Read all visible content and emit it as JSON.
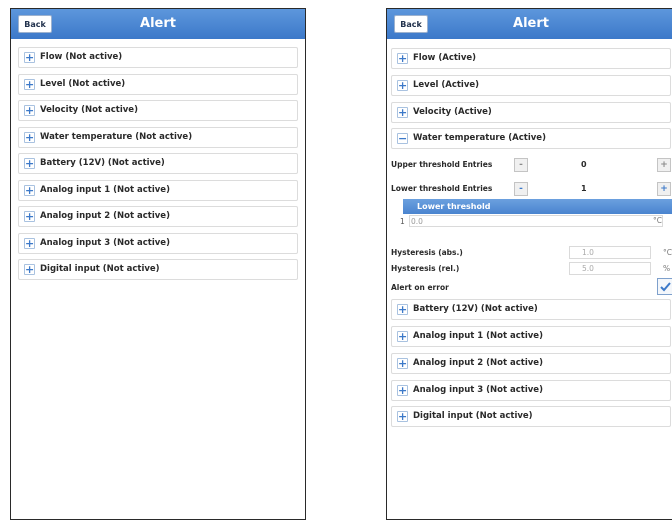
{
  "left": {
    "title": "Alert",
    "back_label": "Back",
    "items": [
      "Flow (Not active)",
      "Level (Not active)",
      "Velocity (Not active)",
      "Water temperature (Not active)",
      "Battery (12V) (Not active)",
      "Analog input 1 (Not active)",
      "Analog input 2 (Not active)",
      "Analog input 3 (Not active)",
      "Digital input (Not active)"
    ]
  },
  "right": {
    "title": "Alert",
    "back_label": "Back",
    "top_items": [
      "Flow (Active)",
      "Level (Active)",
      "Velocity (Active)"
    ],
    "expanded_item": "Water temperature (Active)",
    "upper_threshold": {
      "label": "Upper threshold Entries",
      "minus": "-",
      "value": "0",
      "plus": "+"
    },
    "lower_threshold": {
      "label": "Lower threshold Entries",
      "minus": "-",
      "value": "1",
      "plus": "+"
    },
    "threshold_header": "Lower threshold",
    "threshold_rows": [
      {
        "index": "1",
        "value": "0.0",
        "unit": "°C"
      }
    ],
    "hysteresis_abs": {
      "label": "Hysteresis (abs.)",
      "value": "1.0",
      "unit": "°C"
    },
    "hysteresis_rel": {
      "label": "Hysteresis (rel.)",
      "value": "5.0",
      "unit": "%"
    },
    "alert_on_error": {
      "label": "Alert on error",
      "checked": true
    },
    "bottom_items": [
      "Battery (12V) (Not active)",
      "Analog input 1 (Not active)",
      "Analog input 2 (Not active)",
      "Analog input 3 (Not active)",
      "Digital input (Not active)"
    ]
  },
  "colors": {
    "header": "#3c79c9",
    "accent": "#4a84cf"
  }
}
